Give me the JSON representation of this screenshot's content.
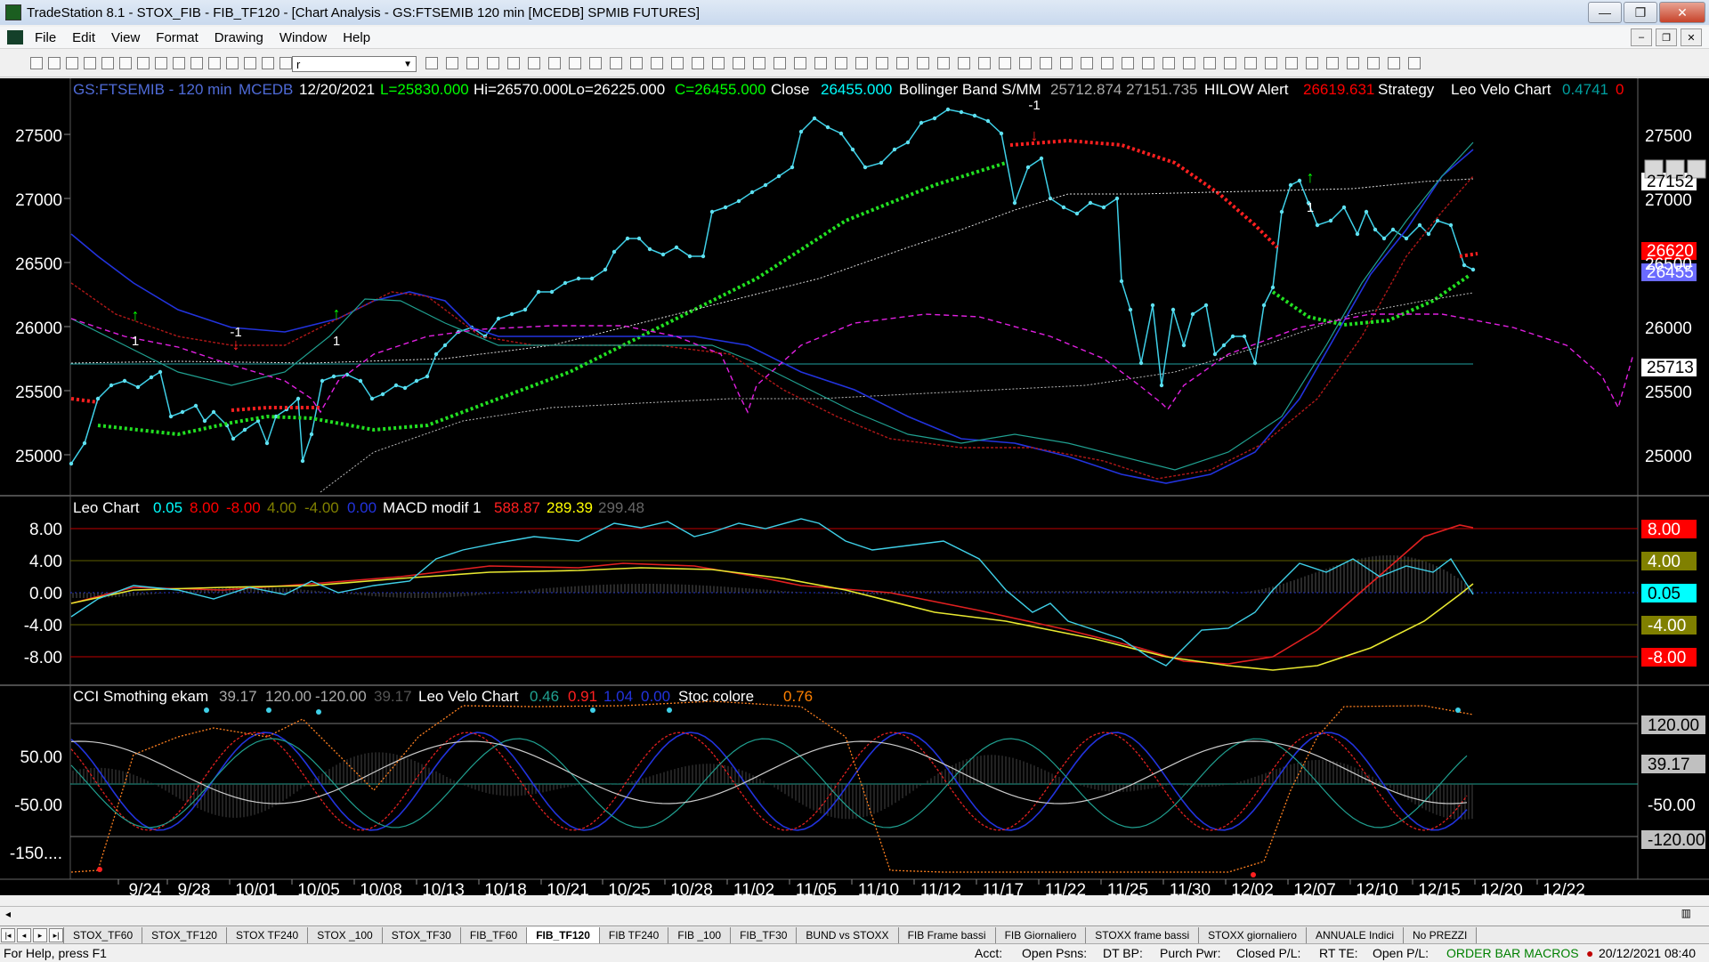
{
  "window": {
    "title": "TradeStation 8.1 - STOX_FIB - FIB_TF120 - [Chart Analysis - GS:FTSEMIB  120 min  [MCEDB] SPMIB FUTURES]",
    "buttons": {
      "minimize": "—",
      "maximize": "❐",
      "close": "✕"
    }
  },
  "menu": [
    "File",
    "Edit",
    "View",
    "Format",
    "Drawing",
    "Window",
    "Help"
  ],
  "toolbar": {
    "symbol_value": "r"
  },
  "chart": {
    "header": {
      "symbol": "GS:FTSEMIB - 120 min",
      "source": "MCEDB",
      "date": "12/20/2021",
      "low_tag": "L=25830.000",
      "high": "Hi=26570.000",
      "low": "Lo=26225.000",
      "close_tag": "C=26455.000",
      "close_label": "Close",
      "close_value": "26455.000",
      "bb_label": "Bollinger Band S/MM",
      "bb_values": "25712.874  27151.735",
      "hilow_label": "HILOW Alert",
      "hilow_value": "26619.631",
      "strategy_label": "Strategy",
      "leovelo_label": "Leo Velo Chart",
      "leovelo_v1": "0.4741",
      "leovelo_v2": "0"
    },
    "price_axis": [
      "27500",
      "27000",
      "26500",
      "26000",
      "25500",
      "25000"
    ],
    "price_tags": [
      {
        "text": "27152",
        "bg": "#ffffff",
        "fg": "#000000"
      },
      {
        "text": "26620",
        "bg": "#ff0000",
        "fg": "#ffffff"
      },
      {
        "text": "26455",
        "bg": "#6b6bff",
        "fg": "#ffffff"
      },
      {
        "text": "25713",
        "bg": "#ffffff",
        "fg": "#000000"
      }
    ],
    "signals": {
      "buy": "1",
      "sell": "-1"
    },
    "panel2": {
      "header": {
        "name": "Leo Chart",
        "v1": "0.05",
        "v2": "8.00",
        "v3": "-8.00",
        "v4": "4.00",
        "v5": "-4.00",
        "v6": "0.00",
        "macd_label": "MACD modif 1",
        "m1": "588.87",
        "m2": "289.39",
        "m3": "299.48"
      },
      "axis": [
        "8.00",
        "4.00",
        "0.00",
        "-4.00",
        "-8.00"
      ],
      "tags": [
        {
          "text": "8.00",
          "bg": "#ff0000",
          "fg": "#ffffff"
        },
        {
          "text": "4.00",
          "bg": "#808000",
          "fg": "#ffffff"
        },
        {
          "text": "0.05",
          "bg": "#00ffff",
          "fg": "#000000"
        },
        {
          "text": "-4.00",
          "bg": "#808000",
          "fg": "#ffffff"
        },
        {
          "text": "-8.00",
          "bg": "#ff0000",
          "fg": "#ffffff"
        }
      ]
    },
    "panel3": {
      "header": {
        "name": "CCI Smothing ekam",
        "v1": "39.17",
        "v2": "120.00",
        "v3": "-120.00",
        "v4": "39.17",
        "velo_label": "Leo Velo Chart",
        "c1": "0.46",
        "c2": "0.91",
        "c3": "1.04",
        "c4": "0.00",
        "stoc_label": "Stoc colore",
        "s1": "0.76"
      },
      "axis": [
        "50.00",
        "-50.00",
        "-150...."
      ],
      "tags": [
        {
          "text": "120.00",
          "bg": "#c0c0c0",
          "fg": "#000000"
        },
        {
          "text": "39.17",
          "bg": "#c0c0c0",
          "fg": "#000000"
        },
        {
          "text": "-50.00",
          "bg": "#000000",
          "fg": "#ffffff"
        },
        {
          "text": "-120.00",
          "bg": "#c0c0c0",
          "fg": "#000000"
        }
      ]
    },
    "dates": [
      "9/24",
      "9/28",
      "10/01",
      "10/05",
      "10/08",
      "10/13",
      "10/18",
      "10/21",
      "10/25",
      "10/28",
      "11/02",
      "11/05",
      "11/10",
      "11/12",
      "11/17",
      "11/22",
      "11/25",
      "11/30",
      "12/02",
      "12/07",
      "12/10",
      "12/15",
      "12/20",
      "12/22"
    ]
  },
  "tabs": [
    "STOX_TF60",
    "STOX_TF120",
    "STOX TF240",
    "STOX _100",
    "STOX_TF30",
    "FIB_TF60",
    "FIB_TF120",
    "FIB TF240",
    "FIB _100",
    "FIB_TF30",
    "BUND vs STOXX",
    "FIB Frame bassi",
    "FIB Giornaliero",
    "STOXX frame bassi",
    "STOXX giornaliero",
    "ANNUALE Indici",
    "No PREZZI"
  ],
  "active_tab": "FIB_TF120",
  "status": {
    "help": "For Help, press F1",
    "acct": "Acct:",
    "open_psns": "Open Psns:",
    "dt_bp": "DT BP:",
    "purch_pwr": "Purch Pwr:",
    "closed_pl": "Closed P/L:",
    "rt_te": "RT TE:",
    "open_pl": "Open P/L:",
    "macros": "ORDER BAR  MACROS",
    "datetime": "20/12/2021 08:40"
  }
}
